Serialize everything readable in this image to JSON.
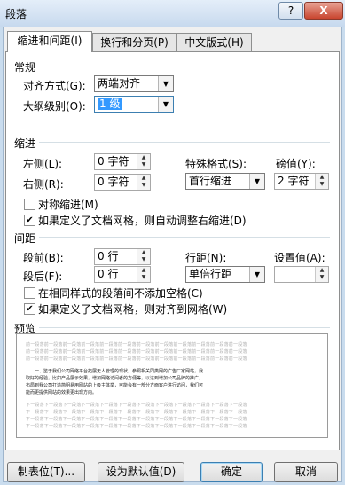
{
  "window": {
    "title": "段落",
    "help": "?",
    "close": "X"
  },
  "tabs": [
    "缩进和间距(I)",
    "换行和分页(P)",
    "中文版式(H)"
  ],
  "general": {
    "heading": "常规",
    "align_label": "对齐方式(G):",
    "align_value": "两端对齐",
    "outline_label": "大纲级别(O):",
    "outline_value": "1 级"
  },
  "indent": {
    "heading": "缩进",
    "left_label": "左侧(L):",
    "left_value": "0 字符",
    "right_label": "右侧(R):",
    "right_value": "0 字符",
    "special_label": "特殊格式(S):",
    "special_value": "首行缩进",
    "by_label": "磅值(Y):",
    "by_value": "2 字符",
    "mirror_label": "对称缩进(M)",
    "mirror_checked": false,
    "grid_label": "如果定义了文档网格，则自动调整右缩进(D)",
    "grid_checked": true
  },
  "spacing": {
    "heading": "间距",
    "before_label": "段前(B):",
    "before_value": "0 行",
    "after_label": "段后(F):",
    "after_value": "0 行",
    "line_label": "行距(N):",
    "line_value": "单倍行距",
    "at_label": "设置值(A):",
    "at_value": "",
    "nospace_label": "在相同样式的段落间不添加空格(C)",
    "nospace_checked": false,
    "snap_label": "如果定义了文档网格，则对齐到网格(W)",
    "snap_checked": true
  },
  "preview": {
    "heading": "预览",
    "before_text": "前一段落前一段落前一段落前一段落前一段落前一段落前一段落前一段落前一段落前一段落前一段落前一段落",
    "main_lines": [
      "一、鉴于我们公司网络平台拓展无人管理的现状，参照相关同类网的广告厂家网站，我",
      "取好的经验，比如产品展示效果，增加网络访问者的方便等，以达到增加公司品牌的推广，",
      "布局到我公司打造简明易用网站的上级主体举，可能会有一部分方面客户进行访问，我们可",
      "能而更提供网站的效果更出现方向。"
    ],
    "after_text": "下一段落下一段落下一段落下一段落下一段落下一段落下一段落下一段落下一段落下一段落下一段落下一段落"
  },
  "buttons": {
    "tabs": "制表位(T)...",
    "default": "设为默认值(D)",
    "ok": "确定",
    "cancel": "取消"
  }
}
